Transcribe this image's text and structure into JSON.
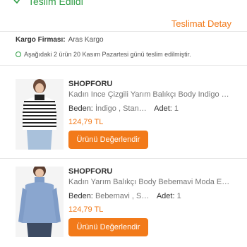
{
  "colors": {
    "accent": "#f27a1a",
    "success": "#2e9d44"
  },
  "status": {
    "icon": "check-icon",
    "text": "Teslim Edildi"
  },
  "detail_link": "Teslimat Detay",
  "cargo": {
    "label": "Kargo Firması:",
    "value": "Aras Kargo"
  },
  "info": {
    "icon": "info-icon",
    "text": "Aşağıdaki 2 ürün 20 Kasım Pazartesi günü teslim edilmiştir."
  },
  "products": [
    {
      "brand": "SHOPFORU",
      "title": "Kadın Ince Çizgili Yarım Balıkçı Body Indigo …",
      "size_label": "Beden:",
      "size_value": "İndigo , Stan…",
      "qty_label": "Adet:",
      "qty_value": "1",
      "price": "124,79 TL",
      "review_label": "Ürünü Değerlendir"
    },
    {
      "brand": "SHOPFORU",
      "title": "Kadın Yarım Balıkçı Body Bebemavi Moda Es…",
      "size_label": "Beden:",
      "size_value": "Bebemavi , S…",
      "qty_label": "Adet:",
      "qty_value": "1",
      "price": "124,79 TL",
      "review_label": "Ürünü Değerlendir"
    }
  ]
}
